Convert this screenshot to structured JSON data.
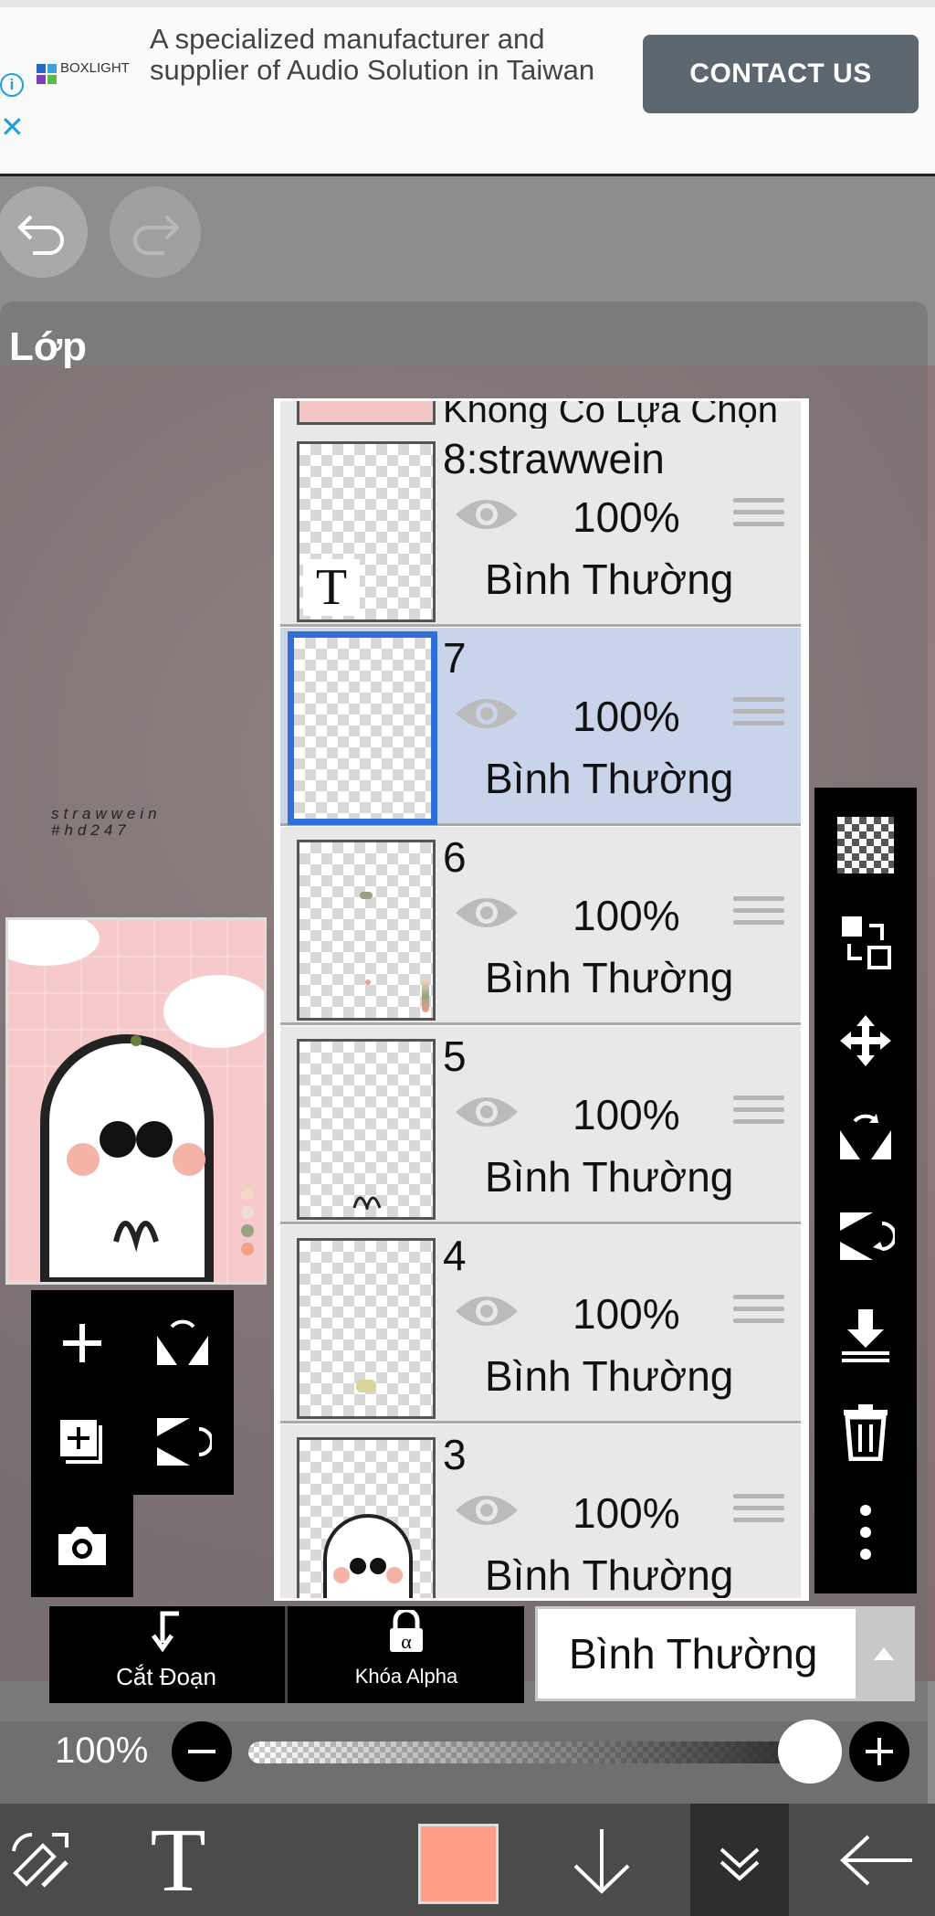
{
  "ad": {
    "brand": "BOXLIGHT",
    "text": "A specialized manufacturer and supplier of Audio Solution in Taiwan",
    "cta": "CONTACT US",
    "info_glyph": "i",
    "close_glyph": "✕"
  },
  "history": {
    "undo_icon": "undo-icon",
    "redo_icon": "redo-icon"
  },
  "panel": {
    "title": "Lớp"
  },
  "canvas_watermark": {
    "line1": "strawwein",
    "line2": "#hd247"
  },
  "layers": [
    {
      "name": "Không Có Lựa Chọn"
    },
    {
      "name": "8:strawwein",
      "opacity": "100%",
      "blend": "Bình Thường",
      "type": "text"
    },
    {
      "name": "7",
      "opacity": "100%",
      "blend": "Bình Thường",
      "selected": true
    },
    {
      "name": "6",
      "opacity": "100%",
      "blend": "Bình Thường"
    },
    {
      "name": "5",
      "opacity": "100%",
      "blend": "Bình Thường"
    },
    {
      "name": "4",
      "opacity": "100%",
      "blend": "Bình Thường"
    },
    {
      "name": "3",
      "opacity": "100%",
      "blend": "Bình Thường"
    }
  ],
  "thumb_text_glyph": "T",
  "right_tools": [
    "checker-icon",
    "swap-layers-icon",
    "move-icon",
    "flip-horizontal-icon",
    "flip-vertical-icon",
    "merge-down-icon",
    "trash-icon",
    "more-icon"
  ],
  "left_tools": [
    "add-layer-icon",
    "flip-horizontal-icon",
    "add-copy-icon",
    "flip-vertical-icon",
    "camera-icon"
  ],
  "options": {
    "clip_label": "Cắt Đoạn",
    "alpha_lock_label": "Khóa Alpha",
    "alpha_glyph": "α"
  },
  "blend_mode": {
    "value": "Bình Thường"
  },
  "opacity": {
    "label": "100%",
    "value": 1.0
  },
  "bottom_toolbar": {
    "text_tool": "T",
    "color": "#ff9d86"
  }
}
